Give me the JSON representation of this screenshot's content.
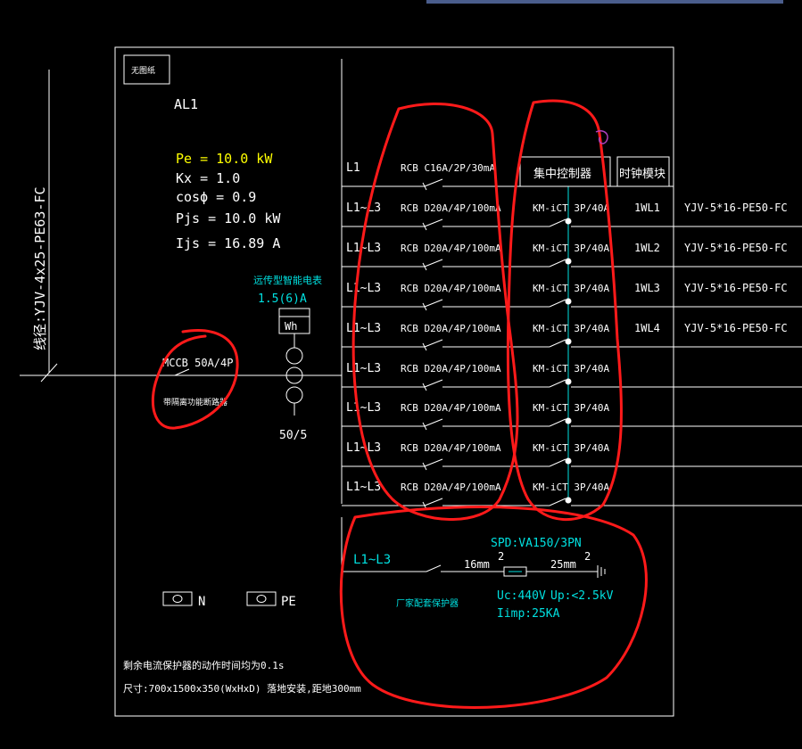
{
  "cable_in": "线径:YJV-4x25-PE63-FC",
  "box_tag": "无图纸",
  "panel": "AL1",
  "params": {
    "pe": "Pe = 10.0 kW",
    "kx": "Kx = 1.0",
    "cos": "cosϕ = 0.9",
    "pjs": "Pjs = 10.0 kW",
    "ijs": "Ijs = 16.89 A"
  },
  "meter": {
    "title": "远传型智能电表",
    "rating": "1.5(6)A",
    "symbol": "Wh",
    "ct": "50/5"
  },
  "main_breaker": {
    "label": "MCCB 50A/4P",
    "note": "带隔离功能断路器"
  },
  "headers": {
    "controller": "集中控制器",
    "clock": "时钟模块"
  },
  "circuits": [
    {
      "phase": "L1",
      "breaker": "RCB C16A/2P/30mA",
      "contactor": "",
      "id": "",
      "cable": ""
    },
    {
      "phase": "L1~L3",
      "breaker": "RCB D20A/4P/100mA",
      "contactor": "KM-iCT 3P/40A",
      "id": "1WL1",
      "cable": "YJV-5*16-PE50-FC"
    },
    {
      "phase": "L1~L3",
      "breaker": "RCB D20A/4P/100mA",
      "contactor": "KM-iCT 3P/40A",
      "id": "1WL2",
      "cable": "YJV-5*16-PE50-FC"
    },
    {
      "phase": "L1~L3",
      "breaker": "RCB D20A/4P/100mA",
      "contactor": "KM-iCT 3P/40A",
      "id": "1WL3",
      "cable": "YJV-5*16-PE50-FC"
    },
    {
      "phase": "L1~L3",
      "breaker": "RCB D20A/4P/100mA",
      "contactor": "KM-iCT 3P/40A",
      "id": "1WL4",
      "cable": "YJV-5*16-PE50-FC"
    },
    {
      "phase": "L1~L3",
      "breaker": "RCB D20A/4P/100mA",
      "contactor": "KM-iCT 3P/40A",
      "id": "",
      "cable": ""
    },
    {
      "phase": "L1~L3",
      "breaker": "RCB D20A/4P/100mA",
      "contactor": "KM-iCT 3P/40A",
      "id": "",
      "cable": ""
    },
    {
      "phase": "L1~L3",
      "breaker": "RCB D20A/4P/100mA",
      "contactor": "KM-iCT 3P/40A",
      "id": "",
      "cable": ""
    },
    {
      "phase": "L1~L3",
      "breaker": "RCB D20A/4P/100mA",
      "contactor": "KM-iCT 3P/40A",
      "id": "",
      "cable": ""
    }
  ],
  "spd": {
    "phase": "L1~L3",
    "title": "SPD:VA150/3PN",
    "wire1": "16mm",
    "n1": "2",
    "wire2": "25mm",
    "n2": "2",
    "uc": "Uc:440V",
    "up": "Up:<2.5kV",
    "iimp": "Iimp:25KA",
    "note": "厂家配套保护器"
  },
  "terminals": {
    "n": "N",
    "pe": "PE"
  },
  "notes": {
    "line1": "剩余电流保护器的动作时间均为0.1s",
    "line2": "尺寸:700x1500x350(WxHxD)  落地安装,距地300mm"
  },
  "colors": {
    "background": "#000000",
    "line": "#ffffff",
    "params": "#ffff00",
    "cyan": "#00e0e0",
    "markup": "#ff1a1a",
    "top_bar": "#4a5d8c"
  }
}
